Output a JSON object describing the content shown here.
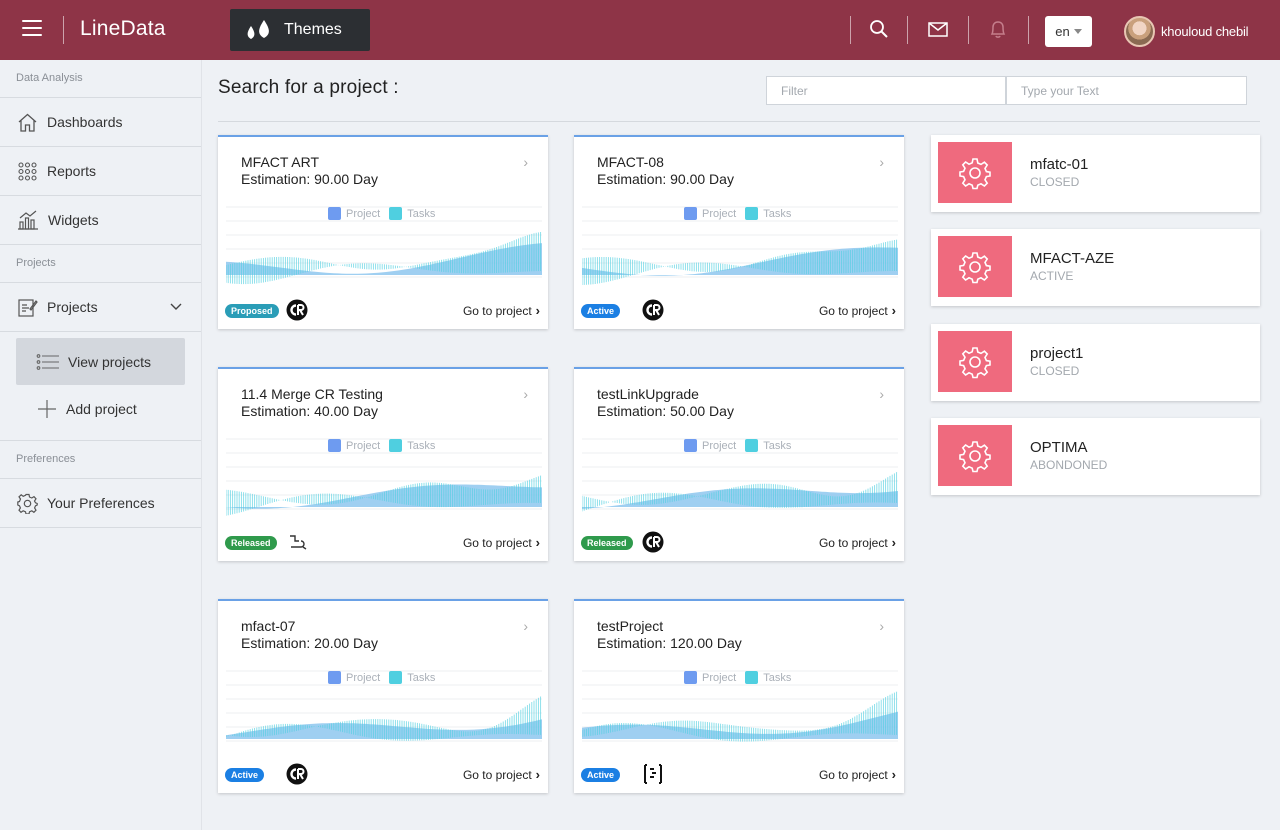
{
  "app": {
    "brand": "LineData",
    "themes_label": "Themes",
    "lang": "en",
    "user_name": "khouloud chebil"
  },
  "sidebar": {
    "section_data_analysis": "Data Analysis",
    "dashboards": "Dashboards",
    "reports": "Reports",
    "widgets": "Widgets",
    "section_projects": "Projects",
    "projects": "Projects",
    "view_projects": "View projects",
    "add_project": "Add project",
    "section_preferences": "Preferences",
    "your_preferences": "Your Preferences"
  },
  "main": {
    "title": "Search for a project :",
    "filter_placeholder": "Filter",
    "text_placeholder": "Type your Text",
    "legend_project": "Project",
    "legend_tasks": "Tasks",
    "goto_label": "Go to project",
    "colors": {
      "project": "#6e9bf0",
      "tasks": "#4fcfe0",
      "accent": "#8e3447"
    },
    "cards": [
      {
        "name": "MFACT ART",
        "estimation": "Estimation: 90.00 Day",
        "status": "Proposed",
        "logo": "cr-logo"
      },
      {
        "name": "MFACT-08",
        "estimation": "Estimation: 90.00 Day",
        "status": "Active",
        "logo": "cr-logo"
      },
      {
        "name": "11.4 Merge CR Testing",
        "estimation": "Estimation: 40.00 Day",
        "status": "Released",
        "logo": "step-icon"
      },
      {
        "name": "testLinkUpgrade",
        "estimation": "Estimation: 50.00 Day",
        "status": "Released",
        "logo": "cr-logo"
      },
      {
        "name": "mfact-07",
        "estimation": "Estimation: 20.00 Day",
        "status": "Active",
        "logo": "cr-logo"
      },
      {
        "name": "testProject",
        "estimation": "Estimation: 120.00 Day",
        "status": "Active",
        "logo": "bracket-logo"
      }
    ],
    "recent": [
      {
        "name": "mfatc-01",
        "status": "CLOSED"
      },
      {
        "name": "MFACT-AZE",
        "status": "ACTIVE"
      },
      {
        "name": "project1",
        "status": "CLOSED"
      },
      {
        "name": "OPTIMA",
        "status": "ABONDONED"
      }
    ]
  }
}
